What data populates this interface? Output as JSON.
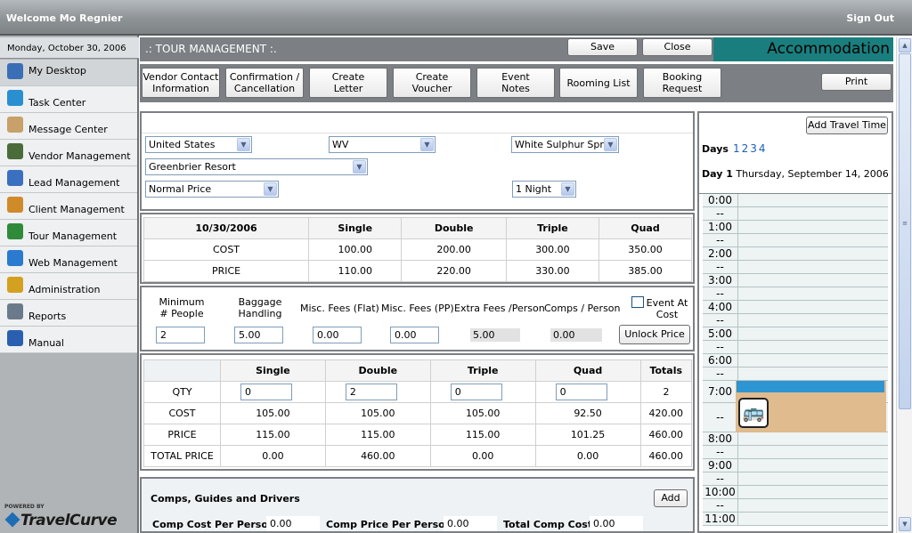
{
  "app": {
    "welcome": "Welcome Mo Regnier",
    "signout": "Sign Out"
  },
  "sidebar": {
    "date": "Monday, October 30, 2006",
    "items": [
      {
        "label": "My Desktop",
        "icon": "desktop-icon",
        "color": "#3a6fb5"
      },
      {
        "label": "Task Center",
        "icon": "task-icon",
        "color": "#2a8fd0"
      },
      {
        "label": "Message Center",
        "icon": "envelope-icon",
        "color": "#c8a06a"
      },
      {
        "label": "Vendor Management",
        "icon": "vendor-icon",
        "color": "#4a6b3a"
      },
      {
        "label": "Lead Management",
        "icon": "lead-icon",
        "color": "#3b6fc0"
      },
      {
        "label": "Client Management",
        "icon": "client-icon",
        "color": "#d08a2a"
      },
      {
        "label": "Tour Management",
        "icon": "globe-icon",
        "color": "#2f8a3a"
      },
      {
        "label": "Web Management",
        "icon": "web-icon",
        "color": "#2a7ad0"
      },
      {
        "label": "Administration",
        "icon": "lock-icon",
        "color": "#d4a020"
      },
      {
        "label": "Reports",
        "icon": "reports-icon",
        "color": "#6a7a8a"
      },
      {
        "label": "Manual",
        "icon": "help-icon",
        "color": "#2a5fb0"
      }
    ],
    "powered": "POWERED BY",
    "logo": "TravelCurve"
  },
  "header": {
    "title": ".: TOUR MANAGEMENT :.",
    "save": "Save",
    "close": "Close",
    "section": "Accommodation"
  },
  "tabs": [
    "Vendor Contact\nInformation",
    "Confirmation /\nCancellation",
    "Create\nLetter",
    "Create\nVoucher",
    "Event\nNotes",
    "Rooming List",
    "Booking\nRequest"
  ],
  "print": "Print",
  "location": {
    "country": "United States",
    "state": "WV",
    "city": "White Sulphur Sprin",
    "property": "Greenbrier Resort",
    "price_type": "Normal Price",
    "nights": "1 Night"
  },
  "rates": {
    "date": "10/30/2006",
    "headers": [
      "Single",
      "Double",
      "Triple",
      "Quad"
    ],
    "cost_label": "COST",
    "price_label": "PRICE",
    "cost": [
      "100.00",
      "200.00",
      "300.00",
      "350.00"
    ],
    "price": [
      "110.00",
      "220.00",
      "330.00",
      "385.00"
    ]
  },
  "fees": {
    "min_label": "Minimum\n# People",
    "bag_label": "Baggage\nHandling",
    "flat_label": "Misc. Fees (Flat)",
    "pp_label": "Misc. Fees (PP)",
    "extra_label": "Extra Fees /Person",
    "comps_label": "Comps / Person",
    "event_label": "Event At\nCost",
    "min": "2",
    "bag": "5.00",
    "flat": "0.00",
    "pp": "0.00",
    "extra": "5.00",
    "comps": "0.00",
    "unlock": "Unlock Price"
  },
  "totals": {
    "headers": [
      "Single",
      "Double",
      "Triple",
      "Quad",
      "Totals"
    ],
    "qty_label": "QTY",
    "cost_label": "COST",
    "price_label": "PRICE",
    "total_label": "TOTAL PRICE",
    "qty": [
      "0",
      "2",
      "0",
      "0",
      "2"
    ],
    "cost": [
      "105.00",
      "105.00",
      "105.00",
      "92.50",
      "420.00"
    ],
    "price": [
      "115.00",
      "115.00",
      "115.00",
      "101.25",
      "460.00"
    ],
    "total": [
      "0.00",
      "460.00",
      "0.00",
      "0.00",
      "460.00"
    ]
  },
  "comps": {
    "title": "Comps, Guides and Drivers",
    "add": "Add",
    "cost_pp_label": "Comp Cost Per Person",
    "cost_pp": "0.00",
    "price_pp_label": "Comp Price Per Person",
    "price_pp": "0.00",
    "total_label": "Total Comp Cost",
    "total": "0.00"
  },
  "schedule": {
    "add_travel": "Add Travel Time",
    "days_label": "Days",
    "days": [
      "1",
      "2",
      "3",
      "4"
    ],
    "day_title": "Day 1",
    "day_date": "Thursday, September 14, 2006",
    "times": [
      "0:00",
      "--",
      "1:00",
      "--",
      "2:00",
      "--",
      "3:00",
      "--",
      "4:00",
      "--",
      "5:00",
      "--",
      "6:00",
      "--",
      "7:00",
      "--",
      "8:00",
      "--",
      "9:00",
      "--",
      "10:00",
      "--",
      "11:00"
    ],
    "event_color": "#2e95d3",
    "event_bg": "#dfbb8e"
  }
}
